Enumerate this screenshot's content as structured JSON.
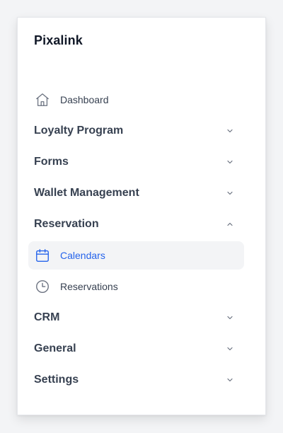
{
  "brand": {
    "name": "Pixalink"
  },
  "nav": {
    "dashboard": {
      "label": "Dashboard",
      "icon": "home-icon"
    },
    "loyalty_program": {
      "label": "Loyalty Program",
      "expanded": false
    },
    "forms": {
      "label": "Forms",
      "expanded": false
    },
    "wallet_management": {
      "label": "Wallet Management",
      "expanded": false
    },
    "reservation": {
      "label": "Reservation",
      "expanded": true,
      "children": [
        {
          "label": "Calendars",
          "icon": "calendar-icon",
          "active": true
        },
        {
          "label": "Reservations",
          "icon": "clock-icon",
          "active": false
        }
      ]
    },
    "crm": {
      "label": "CRM",
      "expanded": false
    },
    "general": {
      "label": "General",
      "expanded": false
    },
    "settings": {
      "label": "Settings",
      "expanded": false
    }
  },
  "colors": {
    "accent": "#2563eb",
    "active_bg": "#f3f4f6",
    "text": "#374151",
    "muted_icon": "#6b7280"
  }
}
